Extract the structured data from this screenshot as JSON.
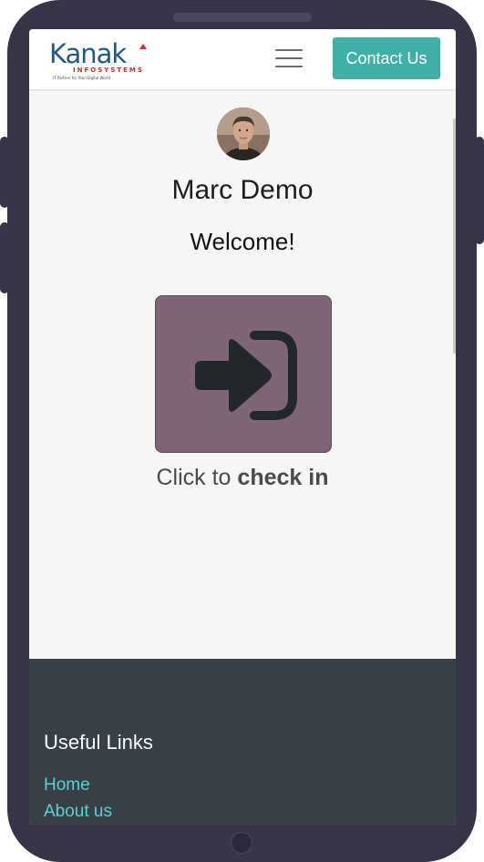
{
  "header": {
    "logo": {
      "main": "Kanak",
      "sub": "INFOSYSTEMS",
      "tagline": "IT Partner for Your Digital World"
    },
    "menu_icon": "hamburger-menu-icon",
    "contact_label": "Contact Us"
  },
  "main": {
    "avatar_icon": "user-avatar",
    "user_name": "Marc Demo",
    "welcome": "Welcome!",
    "checkin_icon": "sign-in-icon",
    "label_prefix": "Click to",
    "label_action": "check in"
  },
  "footer": {
    "title": "Useful Links",
    "links": [
      {
        "label": "Home"
      },
      {
        "label": "About us"
      }
    ]
  },
  "colors": {
    "contact_button": "#3fb0a7",
    "checkin_button": "#7e6677",
    "footer_bg": "#373f47",
    "footer_link": "#5fd0d0",
    "phone_frame": "#363446"
  }
}
